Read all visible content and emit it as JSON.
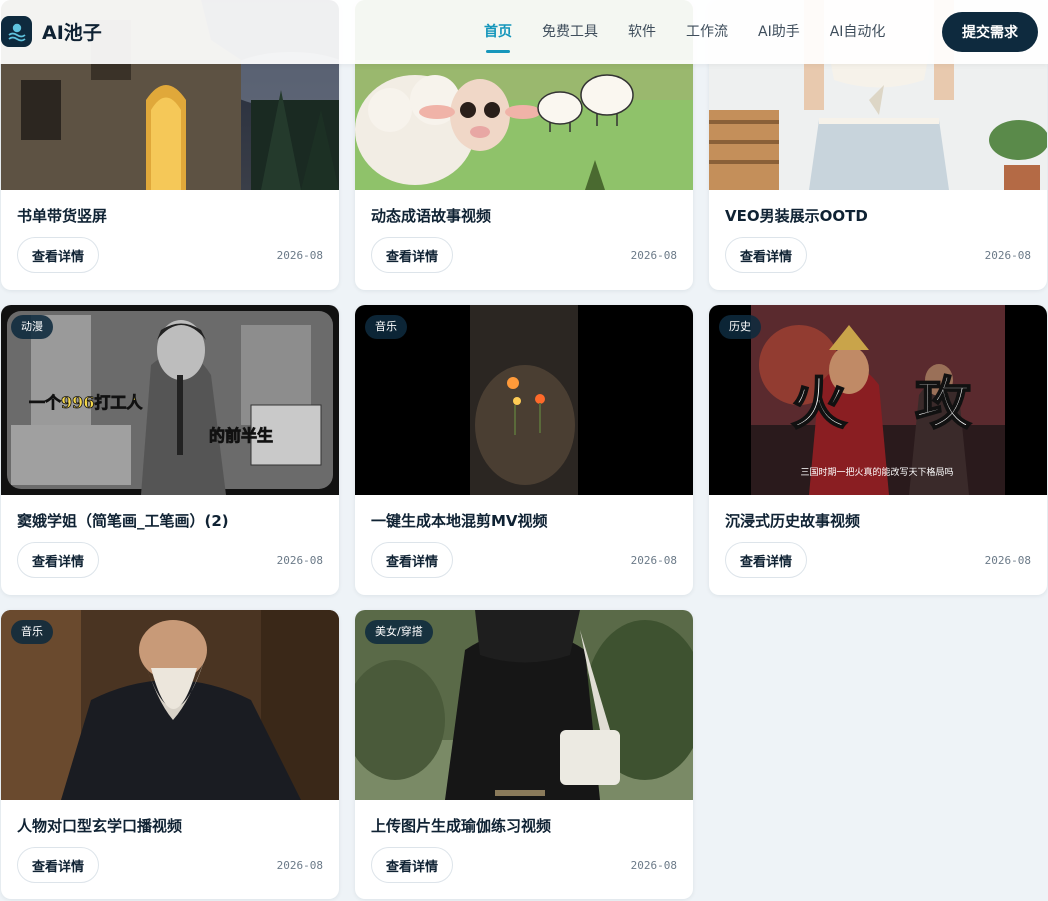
{
  "brand": {
    "name": "AI池子"
  },
  "nav": {
    "items": [
      {
        "label": "首页",
        "active": true
      },
      {
        "label": "免费工具",
        "active": false
      },
      {
        "label": "软件",
        "active": false
      },
      {
        "label": "工作流",
        "active": false
      },
      {
        "label": "AI助手",
        "active": false
      },
      {
        "label": "AI自动化",
        "active": false
      }
    ],
    "submit_label": "提交需求"
  },
  "colors": {
    "primary": "#0e2a3e",
    "accent": "#1596bb",
    "background": "#eef3f7"
  },
  "detail_label": "查看详情",
  "cards": [
    {
      "title": "书单带货竖屏",
      "date": "2026-08",
      "badge": ""
    },
    {
      "title": "动态成语故事视频",
      "date": "2026-08",
      "badge": ""
    },
    {
      "title": "VEO男装展示OOTD",
      "date": "2026-08",
      "badge": ""
    },
    {
      "title": "窦娥学姐（简笔画_工笔画）(2)",
      "date": "2026-08",
      "badge": "动漫",
      "overlay": [
        "一个996打工人",
        "的前半生"
      ]
    },
    {
      "title": "一键生成本地混剪MV视频",
      "date": "2026-08",
      "badge": "音乐"
    },
    {
      "title": "沉浸式历史故事视频",
      "date": "2026-08",
      "badge": "历史",
      "overlay": [
        "火",
        "攻",
        "三国时期一把火真的能改写天下格局吗"
      ]
    },
    {
      "title": "人物对口型玄学口播视频",
      "date": "2026-08",
      "badge": "音乐"
    },
    {
      "title": "上传图片生成瑜伽练习视频",
      "date": "2026-08",
      "badge": "美女/穿搭"
    }
  ]
}
